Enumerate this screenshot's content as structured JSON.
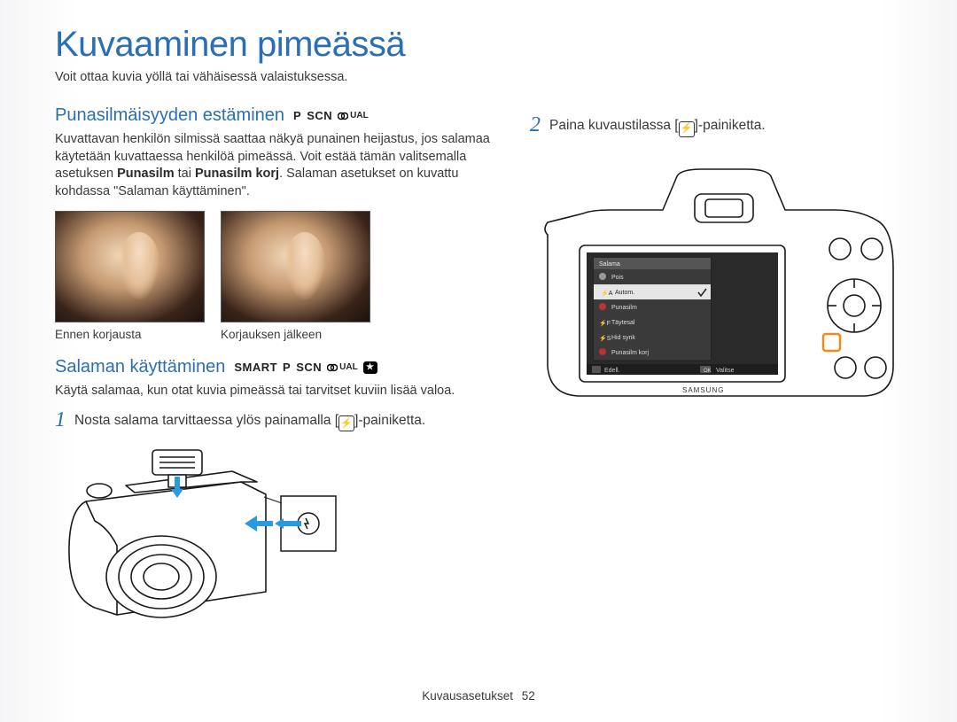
{
  "page_title": "Kuvaaminen pimeässä",
  "page_subtitle": "Voit ottaa kuvia yöllä tai vähäisessä valaistuksessa.",
  "redeye": {
    "heading": "Punasilmäisyyden estäminen",
    "modes": {
      "p": "P",
      "scn": "SCN",
      "dual_label": "UAL"
    },
    "p1a": "Kuvattavan henkilön silmissä saattaa näkyä punainen heijastus, jos salamaa käytetään kuvattaessa henkilöä pimeässä. Voit estää tämän valitsemalla asetuksen ",
    "p1_bold1": "Punasilm",
    "p1_mid": " tai ",
    "p1_bold2": "Punasilm korj",
    "p1b": ". Salaman asetukset on kuvattu kohdassa \"Salaman käyttäminen\".",
    "caption_before": "Ennen korjausta",
    "caption_after": "Korjauksen jälkeen"
  },
  "flash": {
    "heading": "Salaman käyttäminen",
    "modes": {
      "smart": "SMART",
      "p": "P",
      "scn": "SCN",
      "dual_label": "UAL"
    },
    "p1": "Käytä salamaa, kun otat kuvia pimeässä tai tarvitset kuviin lisää valoa.",
    "step1": {
      "num": "1",
      "pre": "Nosta salama tarvittaessa ylös painamalla [",
      "post": "]-painiketta."
    },
    "step2": {
      "num": "2",
      "pre": "Paina kuvaustilassa [",
      "post": "]-painiketta."
    }
  },
  "lcd": {
    "title": "Salama",
    "items": [
      {
        "label": "Pois"
      },
      {
        "label": "Autom.",
        "selected": true
      },
      {
        "label": "Punasilm"
      },
      {
        "label": "Täytesal"
      },
      {
        "label": "Hid synk"
      },
      {
        "label": "Punasilm korj"
      }
    ],
    "bottom_left": "Edell.",
    "bottom_right": "Valitse"
  },
  "footer": {
    "section": "Kuvausasetukset",
    "page": "52"
  }
}
